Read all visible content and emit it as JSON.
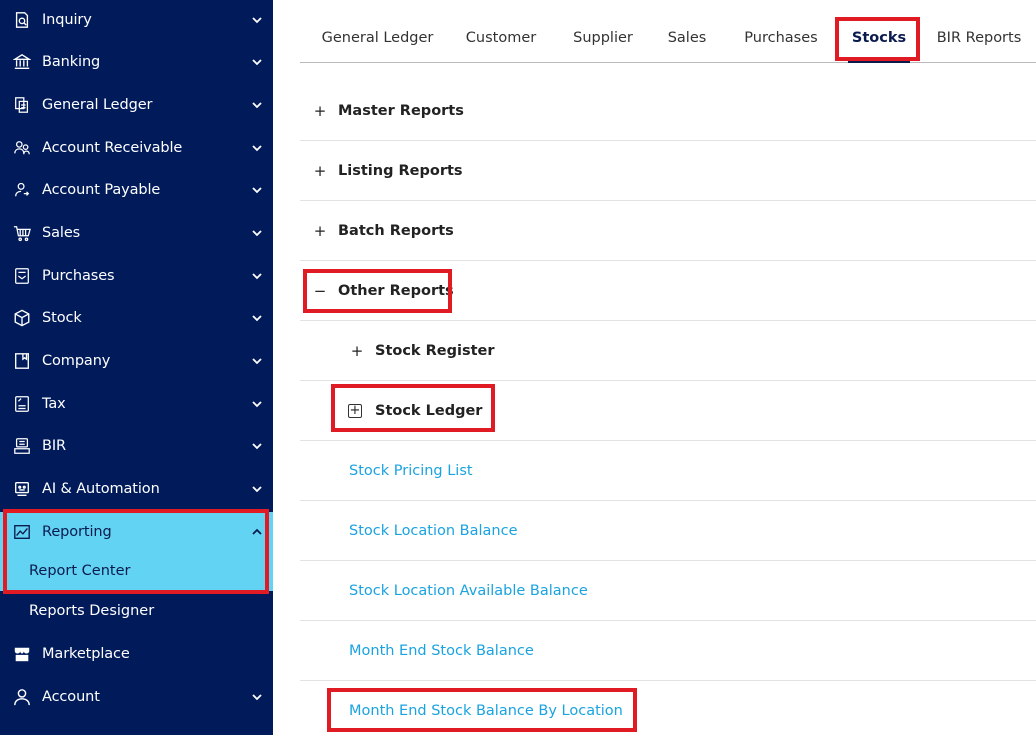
{
  "sidebar": {
    "items": [
      {
        "label": "Inquiry",
        "icon": "inquiry-icon"
      },
      {
        "label": "Banking",
        "icon": "bank-icon"
      },
      {
        "label": "General Ledger",
        "icon": "ledger-icon"
      },
      {
        "label": "Account Receivable",
        "icon": "receivable-icon"
      },
      {
        "label": "Account Payable",
        "icon": "payable-icon"
      },
      {
        "label": "Sales",
        "icon": "cart-icon"
      },
      {
        "label": "Purchases",
        "icon": "purchases-icon"
      },
      {
        "label": "Stock",
        "icon": "box-icon"
      },
      {
        "label": "Company",
        "icon": "company-icon"
      },
      {
        "label": "Tax",
        "icon": "tax-icon"
      },
      {
        "label": "BIR",
        "icon": "bir-icon"
      },
      {
        "label": "AI & Automation",
        "icon": "robot-icon"
      },
      {
        "label": "Reporting",
        "icon": "chart-icon"
      },
      {
        "label": "Marketplace",
        "icon": "store-icon"
      },
      {
        "label": "Account",
        "icon": "user-icon"
      }
    ],
    "reporting_sub": [
      {
        "label": "Report Center"
      },
      {
        "label": "Reports Designer"
      }
    ]
  },
  "tabs": [
    {
      "label": "General Ledger"
    },
    {
      "label": "Customer"
    },
    {
      "label": "Supplier"
    },
    {
      "label": "Sales"
    },
    {
      "label": "Purchases"
    },
    {
      "label": "Stocks"
    },
    {
      "label": "BIR Reports"
    }
  ],
  "reports": {
    "master": {
      "label": "Master Reports",
      "toggle": "+"
    },
    "listing": {
      "label": "Listing Reports",
      "toggle": "+"
    },
    "batch": {
      "label": "Batch Reports",
      "toggle": "+"
    },
    "other": {
      "label": "Other Reports",
      "toggle": "−"
    },
    "stock_register": {
      "label": "Stock Register",
      "toggle": "+"
    },
    "stock_ledger": {
      "label": "Stock Ledger",
      "toggle": "+"
    },
    "links": [
      {
        "label": "Stock Pricing List"
      },
      {
        "label": "Stock Location Balance"
      },
      {
        "label": "Stock Location Available Balance"
      },
      {
        "label": "Month End Stock Balance"
      },
      {
        "label": "Month End Stock Balance By Location"
      }
    ]
  },
  "colors": {
    "sidebar_bg": "#001a5a",
    "active_bg": "#62d3f2",
    "highlight": "#e01b24",
    "link": "#1aa3e0"
  }
}
